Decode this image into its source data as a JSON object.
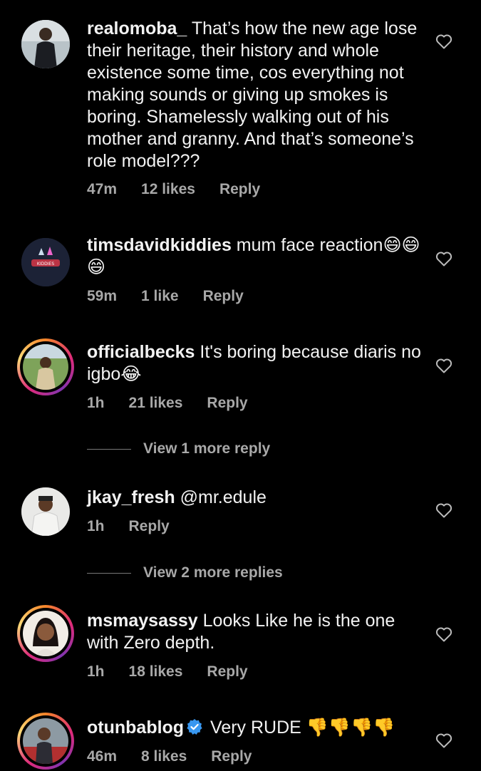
{
  "comments": [
    {
      "username": "realomoba_",
      "text": " That’s how the new age lose their heritage, their history and whole existence some time, cos everything not making sounds or giving up smokes is boring. Shamelessly walking out of his mother and granny. And that’s someone’s role model???",
      "time": "47m",
      "likes": "12 likes",
      "reply": "Reply"
    },
    {
      "username": "timsdavidkiddies",
      "text": " mum face reaction😄😄😄",
      "time": "59m",
      "likes": "1 like",
      "reply": "Reply"
    },
    {
      "username": "officialbecks",
      "text": " It's boring because diaris no igbo😂",
      "time": "1h",
      "likes": "21 likes",
      "reply": "Reply",
      "view_more": "View 1 more reply"
    },
    {
      "username": "jkay_fresh",
      "text": " @mr.edule",
      "time": "1h",
      "likes": "",
      "reply": "Reply",
      "view_more": "View 2 more replies"
    },
    {
      "username": "msmaysassy",
      "text": " Looks Like he is the one with Zero depth.",
      "time": "1h",
      "likes": "18 likes",
      "reply": "Reply"
    },
    {
      "username": "otunbablog",
      "text": " Very RUDE 👎👎👎👎",
      "time": "46m",
      "likes": "8 likes",
      "reply": "Reply",
      "verified": true
    }
  ],
  "icons": {
    "like": "heart-outline-icon",
    "verified": "verified-badge-icon"
  },
  "colors": {
    "background": "#000000",
    "meta": "#a8a8a8",
    "verified": "#3897f0"
  }
}
